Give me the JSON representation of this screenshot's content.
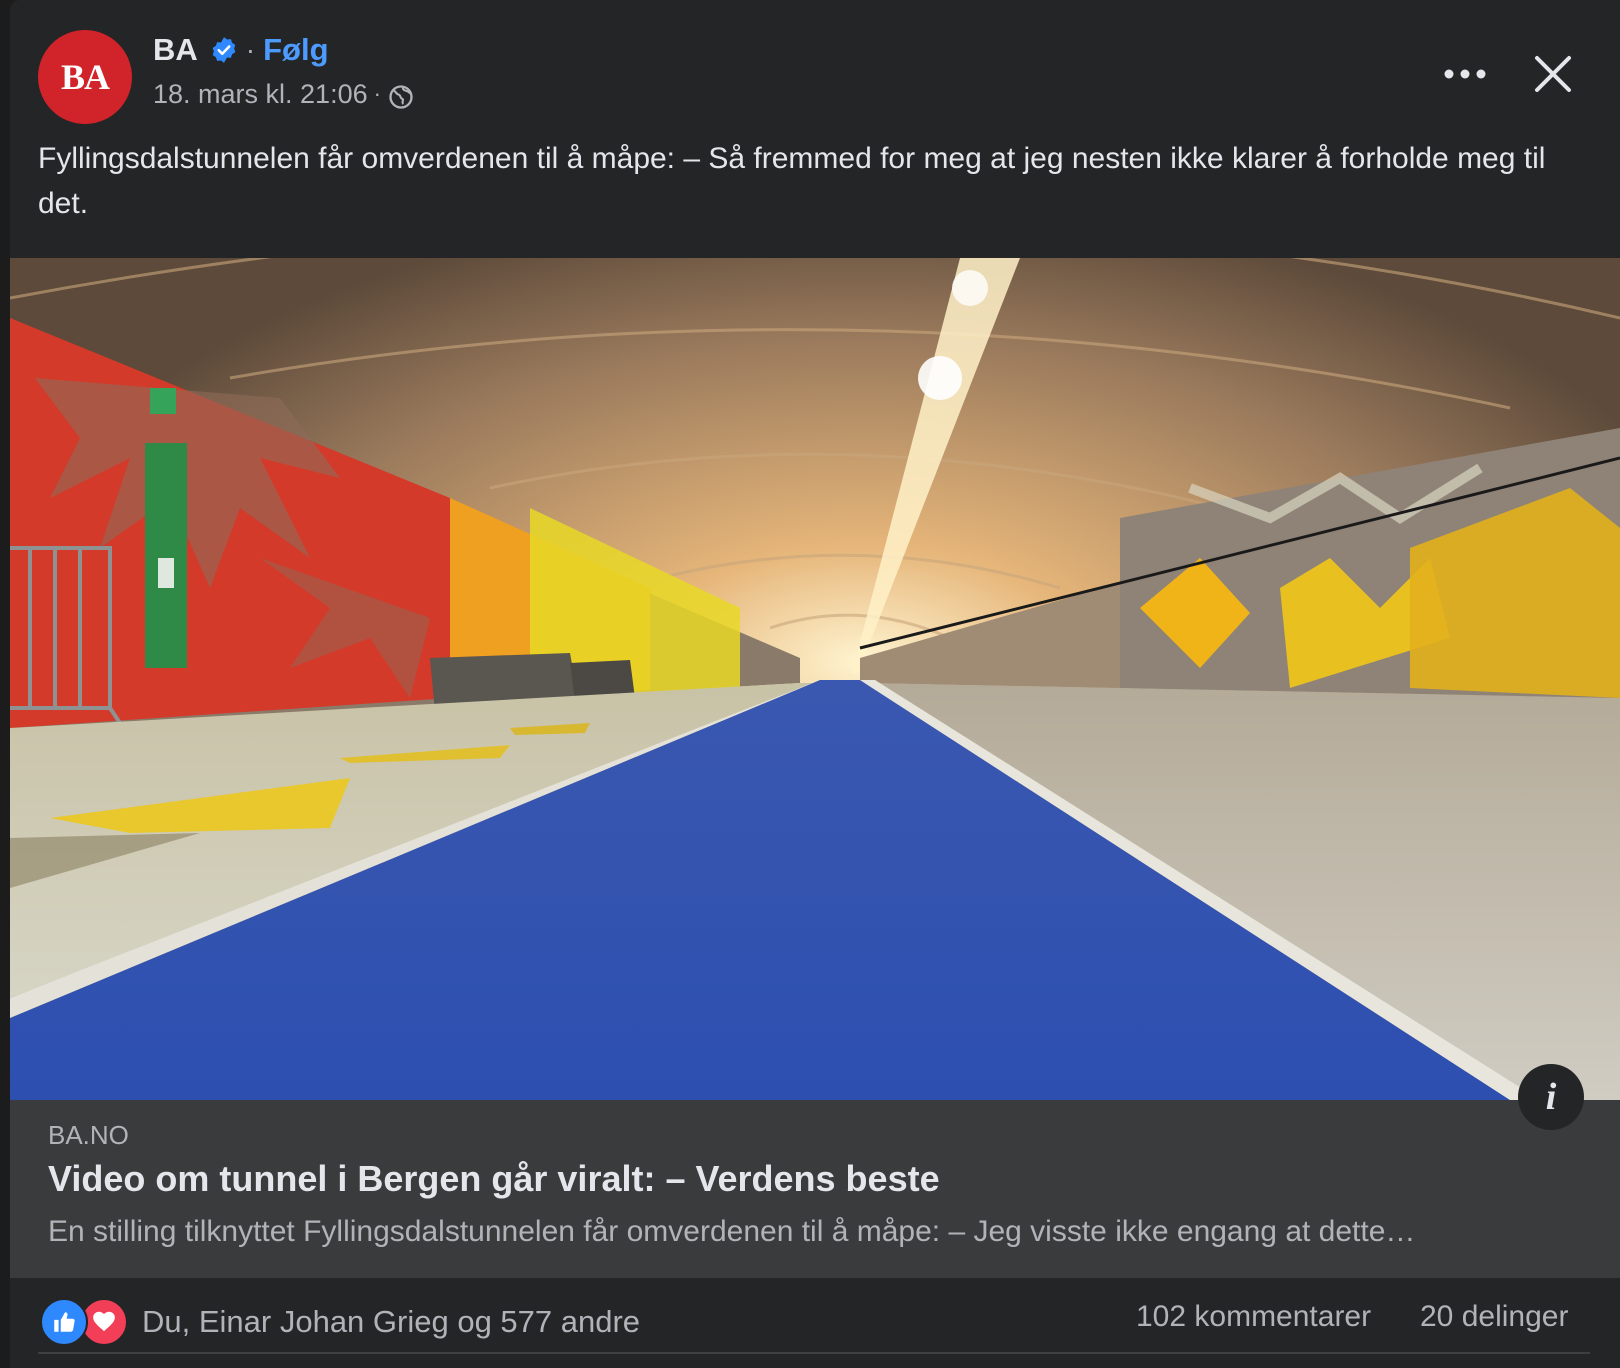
{
  "post": {
    "page_name": "BA",
    "avatar_text": "BA",
    "separator": "·",
    "follow_label": "Følg",
    "timestamp": "18. mars kl. 21:06",
    "meta_separator": "·",
    "text": "Fyllingsdalstunnelen får omverdenen til å måpe: – Så fremmed for meg at jeg nesten ikke klarer å forholde meg til det."
  },
  "link_preview": {
    "domain": "BA.NO",
    "title": "Video om tunnel i Bergen går viralt: – Verdens beste",
    "description": "En stilling tilknyttet Fyllingsdalstunnelen får omverdenen til å måpe: – Jeg visste ikke engang at dette…",
    "info_label": "i"
  },
  "footer": {
    "reactions_text": "Du, Einar Johan Grieg og 577 andre",
    "comments": "102 kommentarer",
    "shares": "20 delinger"
  },
  "colors": {
    "background": "#242526",
    "accent_blue": "#4d9bff",
    "brand_red": "#d1232a",
    "like_blue": "#2e89ff",
    "love_red": "#f33e58"
  },
  "icons": [
    "verified-badge-icon",
    "globe-icon",
    "more-options-icon",
    "close-icon",
    "info-icon",
    "like-reaction-icon",
    "love-reaction-icon"
  ]
}
